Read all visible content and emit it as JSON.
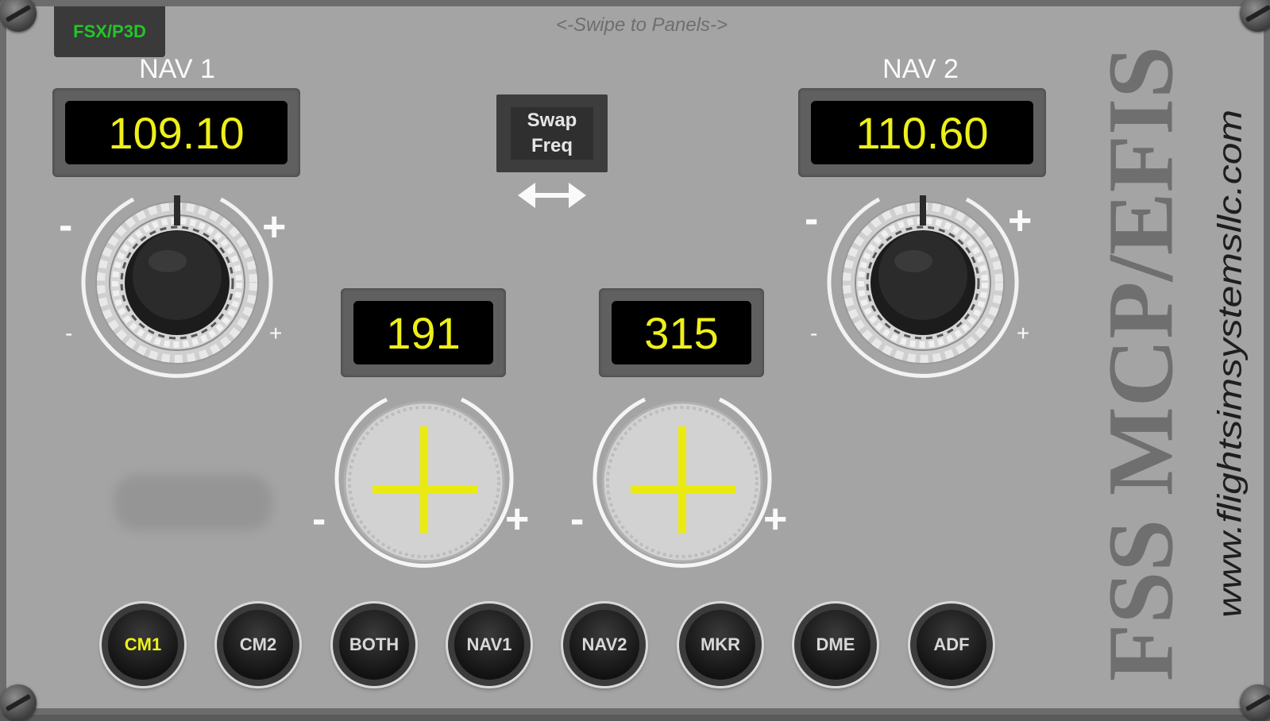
{
  "app": {
    "simulator_badge": "FSX/P3D",
    "swipe_hint": "<-Swipe to Panels->"
  },
  "nav1": {
    "label": "NAV 1",
    "frequency": "109.10"
  },
  "nav2": {
    "label": "NAV 2",
    "frequency": "110.60"
  },
  "swap": {
    "line1": "Swap",
    "line2": "Freq"
  },
  "course_left": {
    "value": "191"
  },
  "course_right": {
    "value": "315"
  },
  "knob_marks": {
    "minus": "-",
    "plus": "+"
  },
  "audio_buttons": [
    {
      "label": "CM1",
      "active": true
    },
    {
      "label": "CM2",
      "active": false
    },
    {
      "label": "BOTH",
      "active": false
    },
    {
      "label": "NAV1",
      "active": false
    },
    {
      "label": "NAV2",
      "active": false
    },
    {
      "label": "MKR",
      "active": false
    },
    {
      "label": "DME",
      "active": false
    },
    {
      "label": "ADF",
      "active": false
    }
  ],
  "branding": {
    "title": "FSS MCP/EFIS",
    "website": "www.flightsimsystemsllc.com"
  },
  "colors": {
    "panel": "#a4a4a4",
    "display_text": "#eef01a",
    "badge_text": "#25c42a",
    "brand_text": "#6f6f6f"
  }
}
